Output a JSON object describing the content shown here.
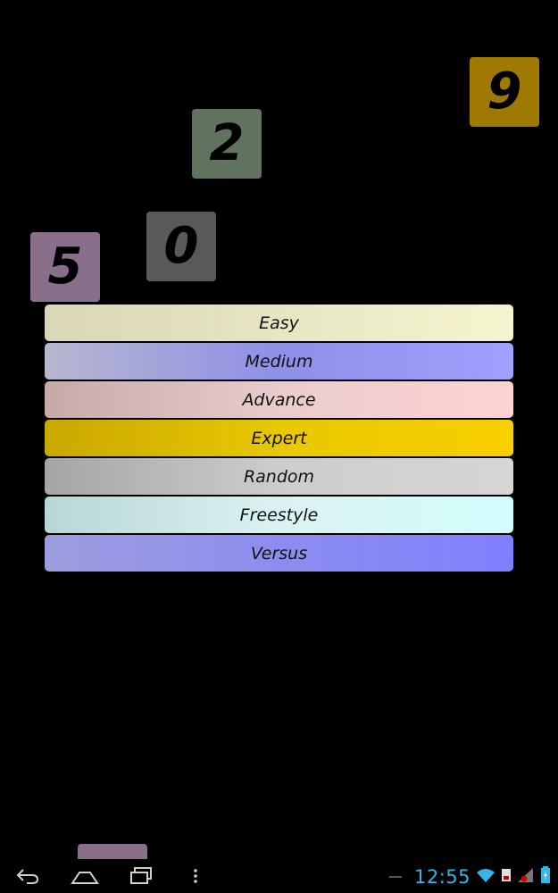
{
  "tiles": [
    {
      "id": "tile-9",
      "digit": "9",
      "color": "#a07a00"
    },
    {
      "id": "tile-2",
      "digit": "2",
      "color": "#5f735f"
    },
    {
      "id": "tile-0",
      "digit": "0",
      "color": "#595959"
    },
    {
      "id": "tile-5",
      "digit": "5",
      "color": "#8a6f8a"
    }
  ],
  "menu": {
    "items": [
      {
        "label": "Easy",
        "color": "#f5f5d0"
      },
      {
        "label": "Medium",
        "color": "#a0a0ff"
      },
      {
        "label": "Advance",
        "color": "#ffd2d2"
      },
      {
        "label": "Expert",
        "color": "#f8cf00"
      },
      {
        "label": "Random",
        "color": "#d6d6d6"
      },
      {
        "label": "Freestyle",
        "color": "#d2fdfd"
      },
      {
        "label": "Versus",
        "color": "#8080ff"
      }
    ]
  },
  "navbar": {
    "icons": [
      "back-icon",
      "home-icon",
      "recent-apps-icon",
      "overflow-menu-icon"
    ]
  },
  "status": {
    "time": "12:55",
    "icons": [
      "wifi-icon",
      "notification-icon",
      "signal-icon",
      "battery-icon"
    ],
    "clock_color": "#35b5e5"
  }
}
